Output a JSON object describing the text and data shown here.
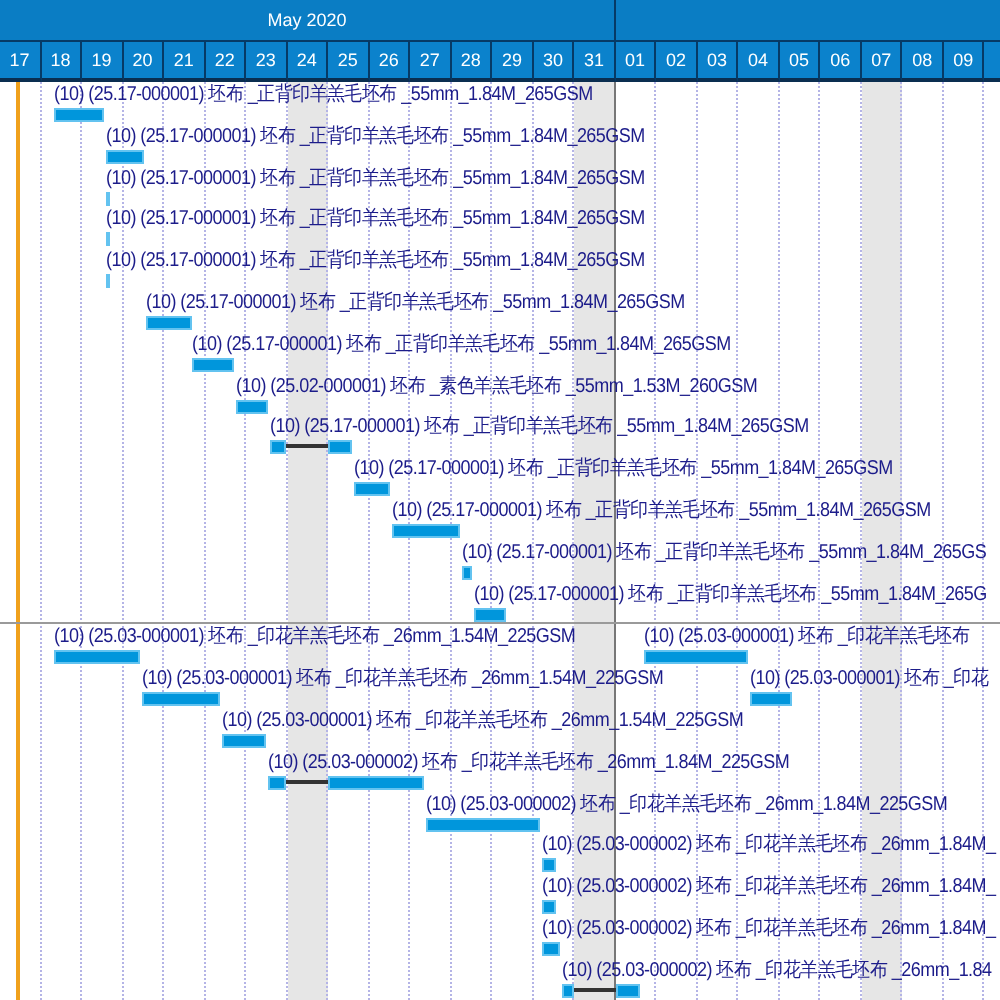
{
  "timeline": {
    "months": [
      {
        "label": "May 2020"
      }
    ],
    "days": [
      {
        "label": "17",
        "weekend": false,
        "today": true
      },
      {
        "label": "18",
        "weekend": false,
        "today": false
      },
      {
        "label": "19",
        "weekend": false,
        "today": false
      },
      {
        "label": "20",
        "weekend": false,
        "today": false
      },
      {
        "label": "21",
        "weekend": false,
        "today": false
      },
      {
        "label": "22",
        "weekend": false,
        "today": false
      },
      {
        "label": "23",
        "weekend": false,
        "today": false
      },
      {
        "label": "24",
        "weekend": true,
        "today": false
      },
      {
        "label": "25",
        "weekend": false,
        "today": false
      },
      {
        "label": "26",
        "weekend": false,
        "today": false
      },
      {
        "label": "27",
        "weekend": false,
        "today": false
      },
      {
        "label": "28",
        "weekend": false,
        "today": false
      },
      {
        "label": "29",
        "weekend": false,
        "today": false
      },
      {
        "label": "30",
        "weekend": false,
        "today": false
      },
      {
        "label": "31",
        "weekend": true,
        "today": false
      },
      {
        "label": "01",
        "weekend": false,
        "today": false
      },
      {
        "label": "02",
        "weekend": false,
        "today": false
      },
      {
        "label": "03",
        "weekend": false,
        "today": false
      },
      {
        "label": "04",
        "weekend": false,
        "today": false
      },
      {
        "label": "05",
        "weekend": false,
        "today": false
      },
      {
        "label": "06",
        "weekend": false,
        "today": false
      },
      {
        "label": "07",
        "weekend": true,
        "today": false
      },
      {
        "label": "08",
        "weekend": false,
        "today": false
      },
      {
        "label": "09",
        "weekend": false,
        "today": false
      }
    ]
  },
  "groups": [
    {
      "tasks": [
        {
          "items": [
            {
              "label": "(10) (25.17-000001) 坯布 _正背印羊羔毛坯布 _55mm_1.84M_265GSM"
            }
          ]
        },
        {
          "items": [
            {
              "label": "(10) (25.17-000001) 坯布 _正背印羊羔毛坯布 _55mm_1.84M_265GSM"
            }
          ]
        },
        {
          "items": [
            {
              "label": "(10) (25.17-000001) 坯布 _正背印羊羔毛坯布 _55mm_1.84M_265GSM"
            }
          ]
        },
        {
          "items": [
            {
              "label": "(10) (25.17-000001) 坯布 _正背印羊羔毛坯布 _55mm_1.84M_265GSM"
            }
          ]
        },
        {
          "items": [
            {
              "label": "(10) (25.17-000001) 坯布 _正背印羊羔毛坯布 _55mm_1.84M_265GSM"
            }
          ]
        },
        {
          "items": [
            {
              "label": "(10) (25.17-000001) 坯布 _正背印羊羔毛坯布 _55mm_1.84M_265GSM"
            }
          ]
        },
        {
          "items": [
            {
              "label": "(10) (25.17-000001) 坯布 _正背印羊羔毛坯布 _55mm_1.84M_265GSM"
            }
          ]
        },
        {
          "items": [
            {
              "label": "(10) (25.02-000001) 坯布 _素色羊羔毛坯布 _55mm_1.53M_260GSM"
            }
          ]
        },
        {
          "items": [
            {
              "label": "(10) (25.17-000001) 坯布 _正背印羊羔毛坯布 _55mm_1.84M_265GSM"
            }
          ]
        },
        {
          "items": [
            {
              "label": "(10) (25.17-000001) 坯布 _正背印羊羔毛坯布 _55mm_1.84M_265GSM"
            }
          ]
        },
        {
          "items": [
            {
              "label": "(10) (25.17-000001) 坯布 _正背印羊羔毛坯布 _55mm_1.84M_265GSM"
            }
          ]
        },
        {
          "items": [
            {
              "label": "(10) (25.17-000001) 坯布 _正背印羊羔毛坯布 _55mm_1.84M_265GS"
            }
          ]
        },
        {
          "items": [
            {
              "label": "(10) (25.17-000001) 坯布 _正背印羊羔毛坯布 _55mm_1.84M_265G"
            }
          ]
        }
      ]
    },
    {
      "tasks": [
        {
          "items": [
            {
              "label": "(10) (25.03-000001) 坯布 _印花羊羔毛坯布 _26mm_1.54M_225GSM"
            },
            {
              "label": "(10) (25.03-000001) 坯布 _印花羊羔毛坯布"
            }
          ]
        },
        {
          "items": [
            {
              "label": "(10) (25.03-000001) 坯布 _印花羊羔毛坯布 _26mm_1.54M_225GSM"
            },
            {
              "label": "(10) (25.03-000001) 坯布 _印花"
            }
          ]
        },
        {
          "items": [
            {
              "label": "(10) (25.03-000001) 坯布 _印花羊羔毛坯布 _26mm_1.54M_225GSM"
            }
          ]
        },
        {
          "items": [
            {
              "label": "(10) (25.03-000002) 坯布 _印花羊羔毛坯布 _26mm_1.84M_225GSM"
            }
          ]
        },
        {
          "items": [
            {
              "label": "(10) (25.03-000002) 坯布 _印花羊羔毛坯布 _26mm_1.84M_225GSM"
            }
          ]
        },
        {
          "items": [
            {
              "label": "(10) (25.03-000002) 坯布 _印花羊羔毛坯布 _26mm_1.84M_"
            }
          ]
        },
        {
          "items": [
            {
              "label": "(10) (25.03-000002) 坯布 _印花羊羔毛坯布 _26mm_1.84M_"
            }
          ]
        },
        {
          "items": [
            {
              "label": "(10) (25.03-000002) 坯布 _印花羊羔毛坯布 _26mm_1.84M_"
            }
          ]
        },
        {
          "items": [
            {
              "label": "(10) (25.03-000002) 坯布 _印花羊羔毛坯布 _26mm_1.84"
            }
          ]
        }
      ]
    }
  ]
}
